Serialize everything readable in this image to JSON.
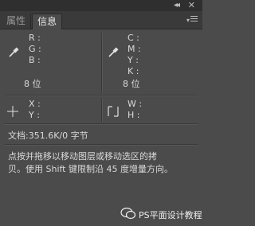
{
  "tabs": [
    {
      "label": "属性",
      "active": false
    },
    {
      "label": "信息",
      "active": true
    }
  ],
  "rgb": {
    "labels": [
      "R :",
      "G :",
      "B :"
    ],
    "bit_depth": "8 位"
  },
  "cmyk": {
    "labels": [
      "C :",
      "M :",
      "Y :",
      "K :"
    ],
    "bit_depth": "8 位"
  },
  "position": {
    "x_label": "X :",
    "y_label": "Y :"
  },
  "size": {
    "w_label": "W :",
    "h_label": "H :"
  },
  "document": {
    "text": "文档:351.6K/0 字节"
  },
  "hint": {
    "line1": "点按并拖移以移动图层或移动选区的拷",
    "line2": "贝。使用 Shift 键限制沿 45 度增量方向。"
  },
  "watermark": {
    "text": "PS平面设计教程"
  },
  "icons": {
    "collapse": "double-chevron-left-icon",
    "close": "close-icon",
    "menu": "panel-menu-icon",
    "eyedropper": "eyedropper-icon",
    "crosshair": "crosshair-icon",
    "size": "size-bracket-icon"
  }
}
